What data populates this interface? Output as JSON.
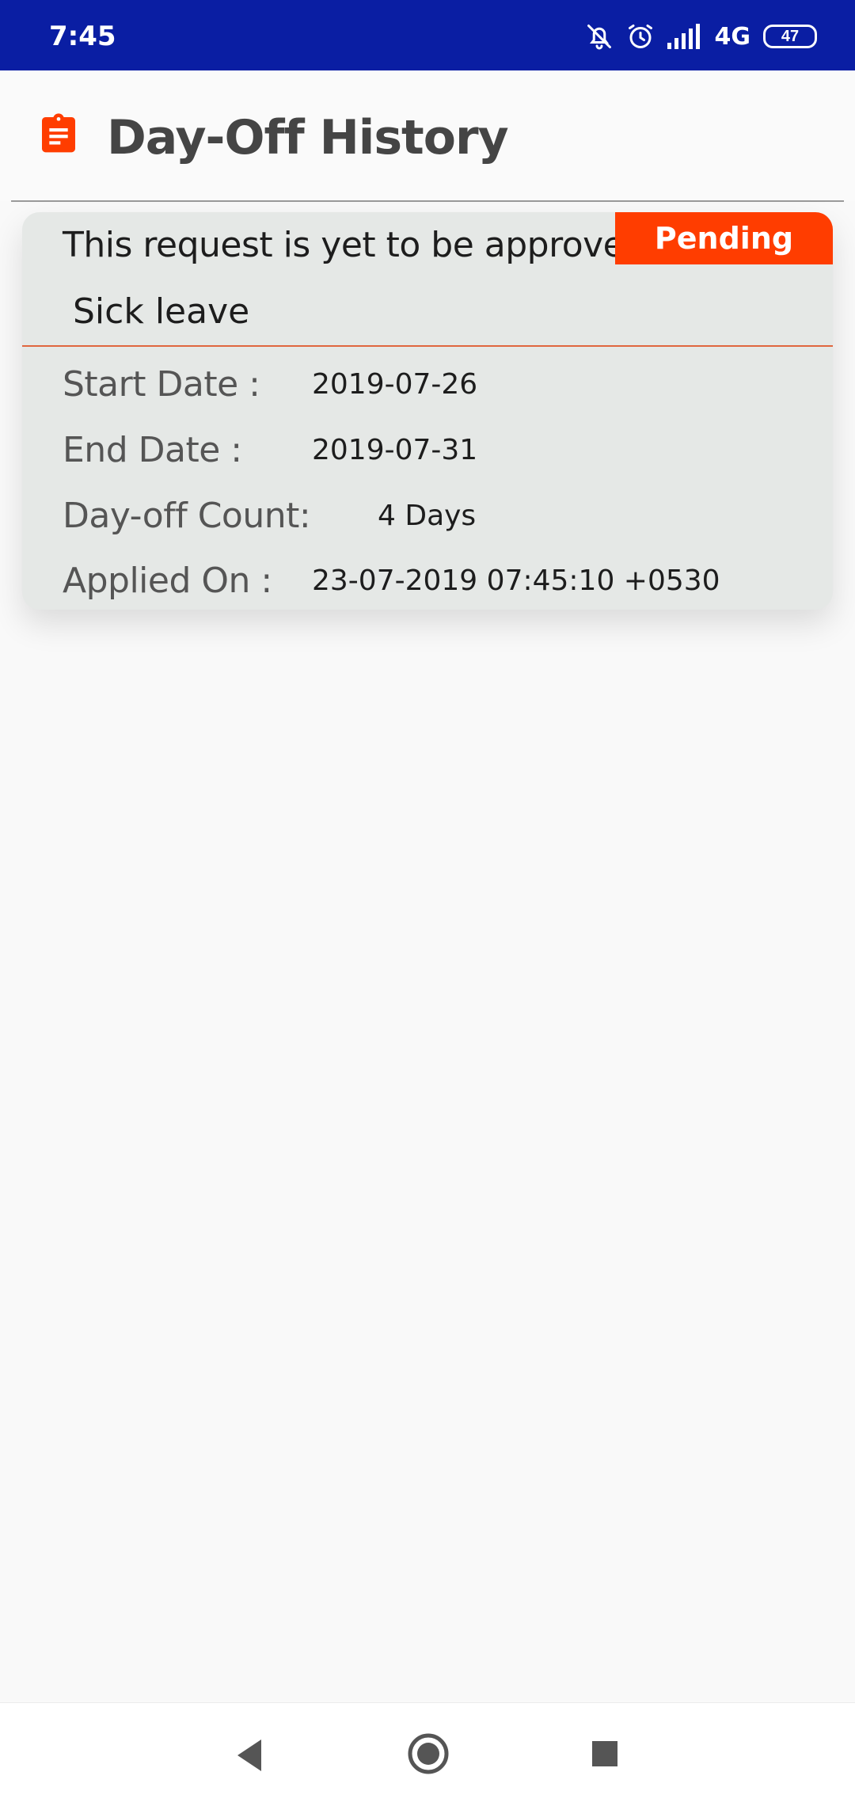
{
  "status_bar": {
    "time": "7:45",
    "network": "4G",
    "battery": "47",
    "icons": [
      "mute-bell-icon",
      "alarm-icon",
      "signal-icon",
      "battery-icon"
    ],
    "background": "#0a1ea3"
  },
  "header": {
    "title": "Day-Off History",
    "icon": "clipboard-icon",
    "accent": "#ff3d00"
  },
  "request": {
    "message": "This request is yet to be approved",
    "status": "Pending",
    "status_color": "#ff3d00",
    "leave_type": "Sick leave",
    "details": {
      "start_date_label": "Start Date :",
      "start_date": "2019-07-26",
      "end_date_label": "End Date :",
      "end_date": "2019-07-31",
      "count_label": "Day-off Count:",
      "count": "4 Days",
      "applied_label": "Applied On :",
      "applied_on": "23-07-2019 07:45:10 +0530"
    }
  },
  "nav": {
    "icons": [
      "back-icon",
      "home-icon",
      "recents-icon"
    ]
  }
}
